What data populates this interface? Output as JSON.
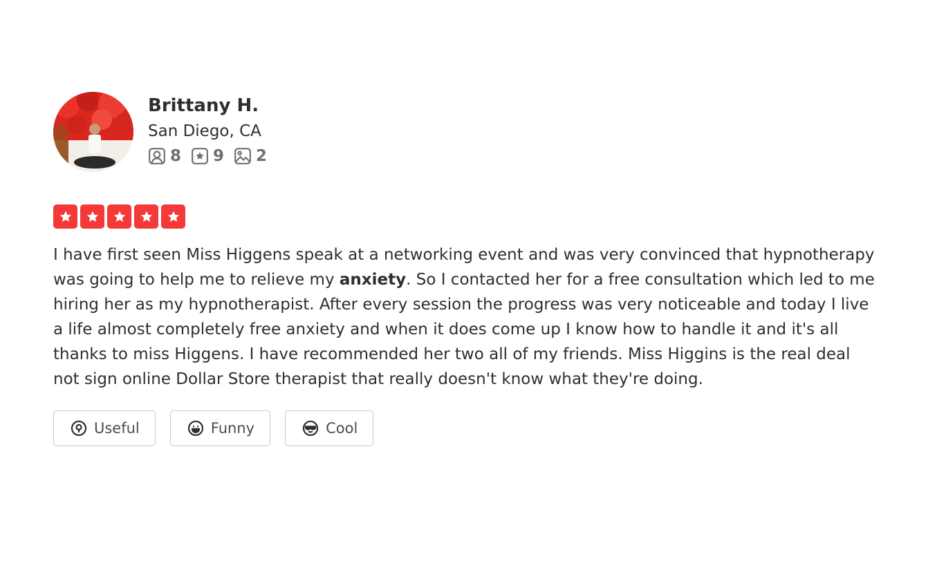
{
  "user": {
    "name": "Brittany H.",
    "location": "San Diego, CA",
    "stats": {
      "friends": "8",
      "reviews": "9",
      "photos": "2"
    }
  },
  "review": {
    "rating": 5,
    "text_part1": "I have first seen Miss Higgens speak at a networking event and was very convinced that hypnotherapy was going to help me to relieve my ",
    "highlight": "anxiety",
    "text_part2": ". So I contacted her for a free consultation which led to me hiring her as my hypnotherapist. After every session the progress was very noticeable and today I live a life almost completely free anxiety and when it does come up I know how to handle it and it's all thanks to miss Higgens. I have recommended her two all of my friends. Miss Higgins is the real deal not sign online Dollar Store therapist that really doesn't know what they're doing."
  },
  "actions": {
    "useful": "Useful",
    "funny": "Funny",
    "cool": "Cool"
  },
  "colors": {
    "star": "#f43939",
    "text": "#2d2e2f",
    "muted": "#6e7072",
    "border": "#c8c9ca"
  },
  "icons": {
    "friends": "friends-icon",
    "reviews": "review-star-icon",
    "photos": "photo-icon",
    "useful": "useful-icon",
    "funny": "funny-icon",
    "cool": "cool-icon"
  }
}
